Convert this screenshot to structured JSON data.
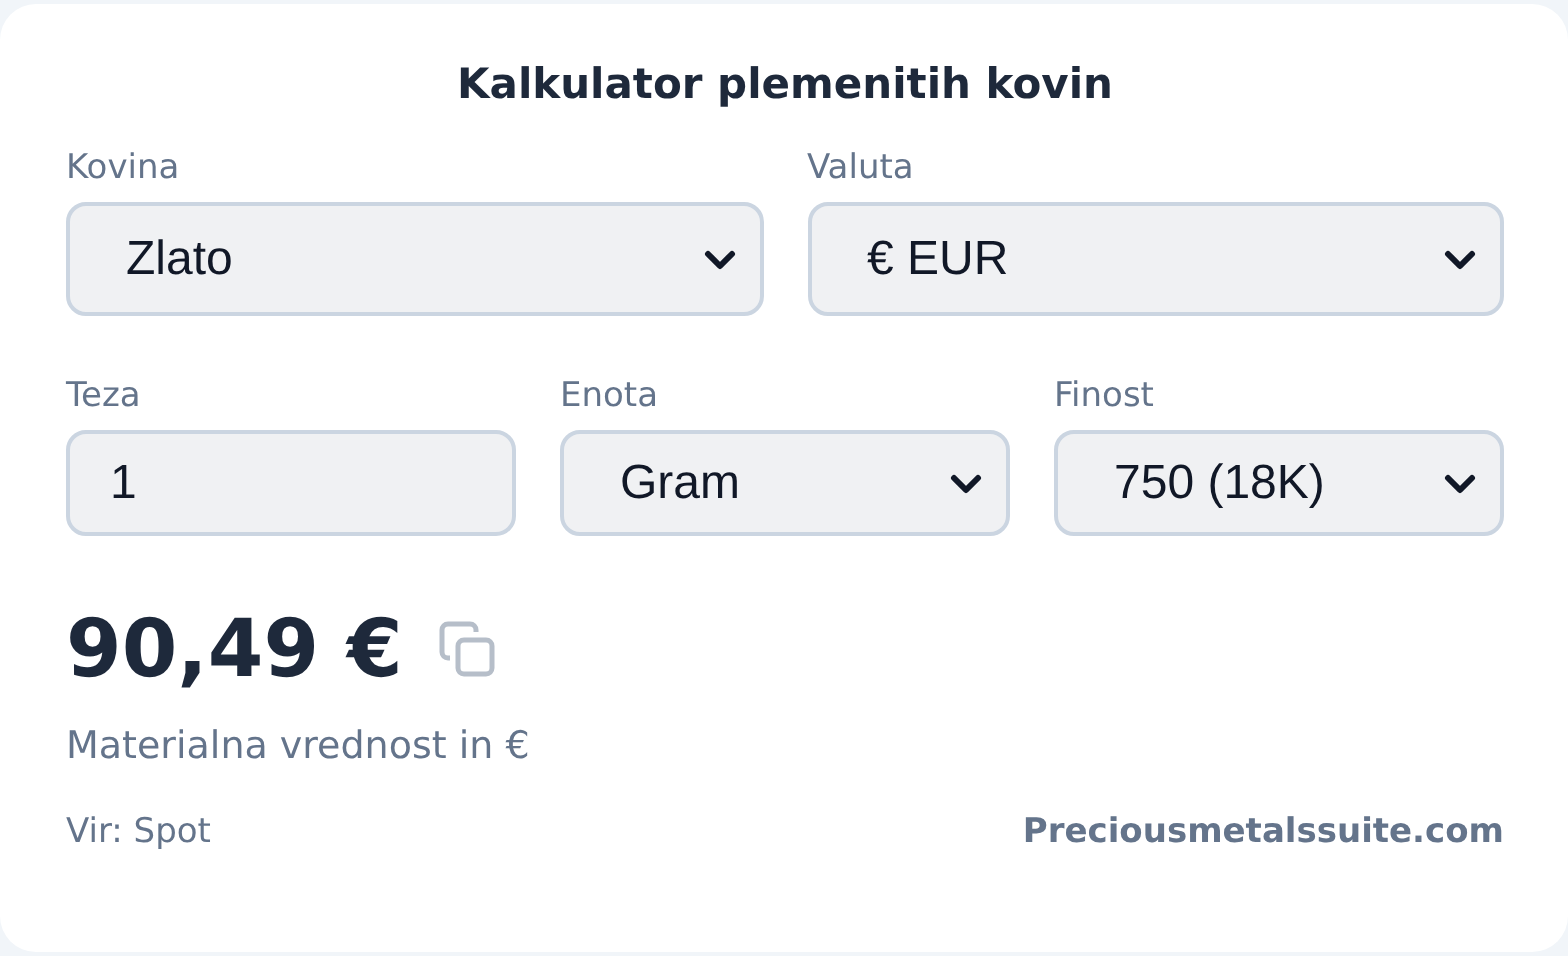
{
  "title": "Kalkulator plemenitih kovin",
  "rows": [
    [
      {
        "label": "Kovina",
        "kind": "select",
        "value": "Zlato"
      },
      {
        "label": "Valuta",
        "kind": "select",
        "value": "€ EUR"
      }
    ],
    [
      {
        "label": "Teza",
        "kind": "input",
        "value": "1"
      },
      {
        "label": "Enota",
        "kind": "select",
        "value": "Gram"
      },
      {
        "label": "Finost",
        "kind": "select",
        "value": "750 (18K)"
      }
    ]
  ],
  "result": {
    "value": "90,49 €",
    "caption": "Materialna vrednost in €"
  },
  "footer": {
    "source": "Vir: Spot",
    "link": "Preciousmetalssuite.com"
  }
}
